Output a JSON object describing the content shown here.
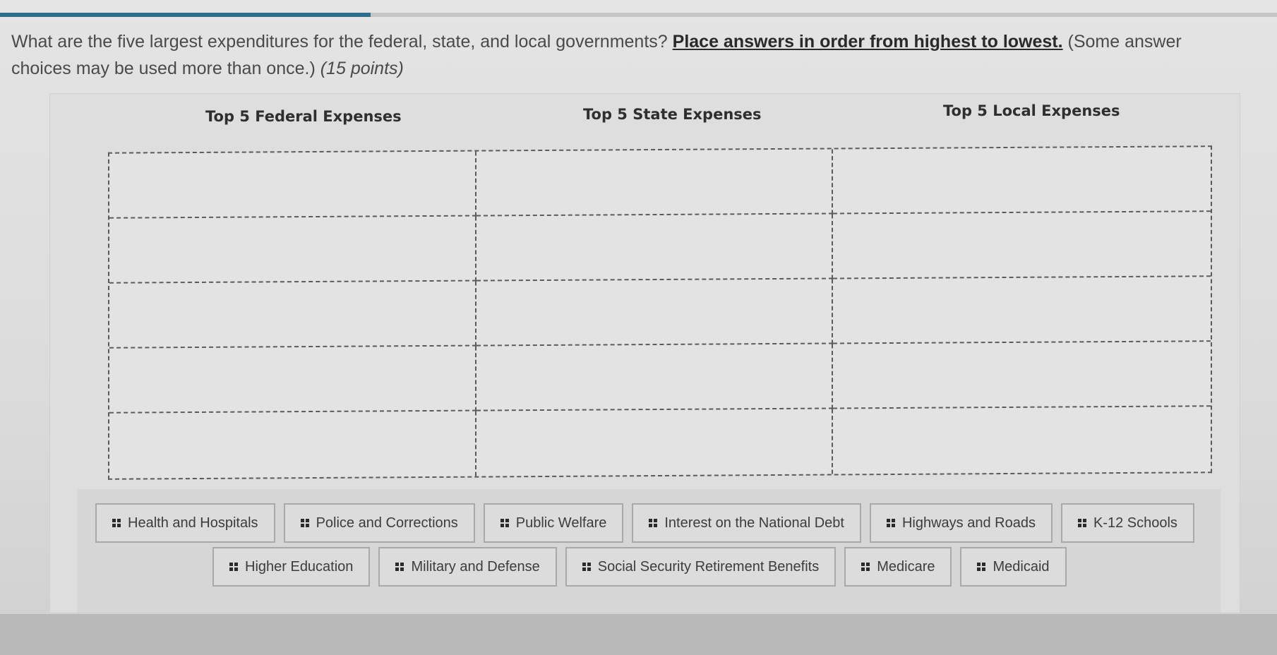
{
  "progress": {
    "fraction": 0.29,
    "color": "#2e6f8e"
  },
  "question": {
    "text": "What are the five largest expenditures for the federal, state, and local governments? ",
    "emphasis": "Place answers in order from highest to lowest.",
    "note": " (Some answer choices may be used more than once.) ",
    "points": "(15 points)"
  },
  "columns": [
    {
      "header": "Top 5 Federal Expenses",
      "slots": [
        "",
        "",
        "",
        "",
        ""
      ]
    },
    {
      "header": "Top 5 State Expenses",
      "slots": [
        "",
        "",
        "",
        "",
        ""
      ]
    },
    {
      "header": "Top 5 Local Expenses",
      "slots": [
        "",
        "",
        "",
        "",
        ""
      ]
    }
  ],
  "answer_bank": {
    "row1": [
      {
        "label": "Health and Hospitals",
        "icon": "drag-handle-icon"
      },
      {
        "label": "Police and Corrections",
        "icon": "drag-handle-icon"
      },
      {
        "label": "Public Welfare",
        "icon": "drag-handle-icon"
      },
      {
        "label": "Interest on the National Debt",
        "icon": "drag-handle-icon"
      },
      {
        "label": "Highways and Roads",
        "icon": "drag-handle-icon"
      },
      {
        "label": "K-12 Schools",
        "icon": "drag-handle-icon"
      }
    ],
    "row2": [
      {
        "label": "Higher Education",
        "icon": "drag-handle-icon"
      },
      {
        "label": "Military and Defense",
        "icon": "drag-handle-icon"
      },
      {
        "label": "Social Security Retirement Benefits",
        "icon": "drag-handle-icon"
      },
      {
        "label": "Medicare",
        "icon": "drag-handle-icon"
      },
      {
        "label": "Medicaid",
        "icon": "drag-handle-icon"
      }
    ]
  }
}
